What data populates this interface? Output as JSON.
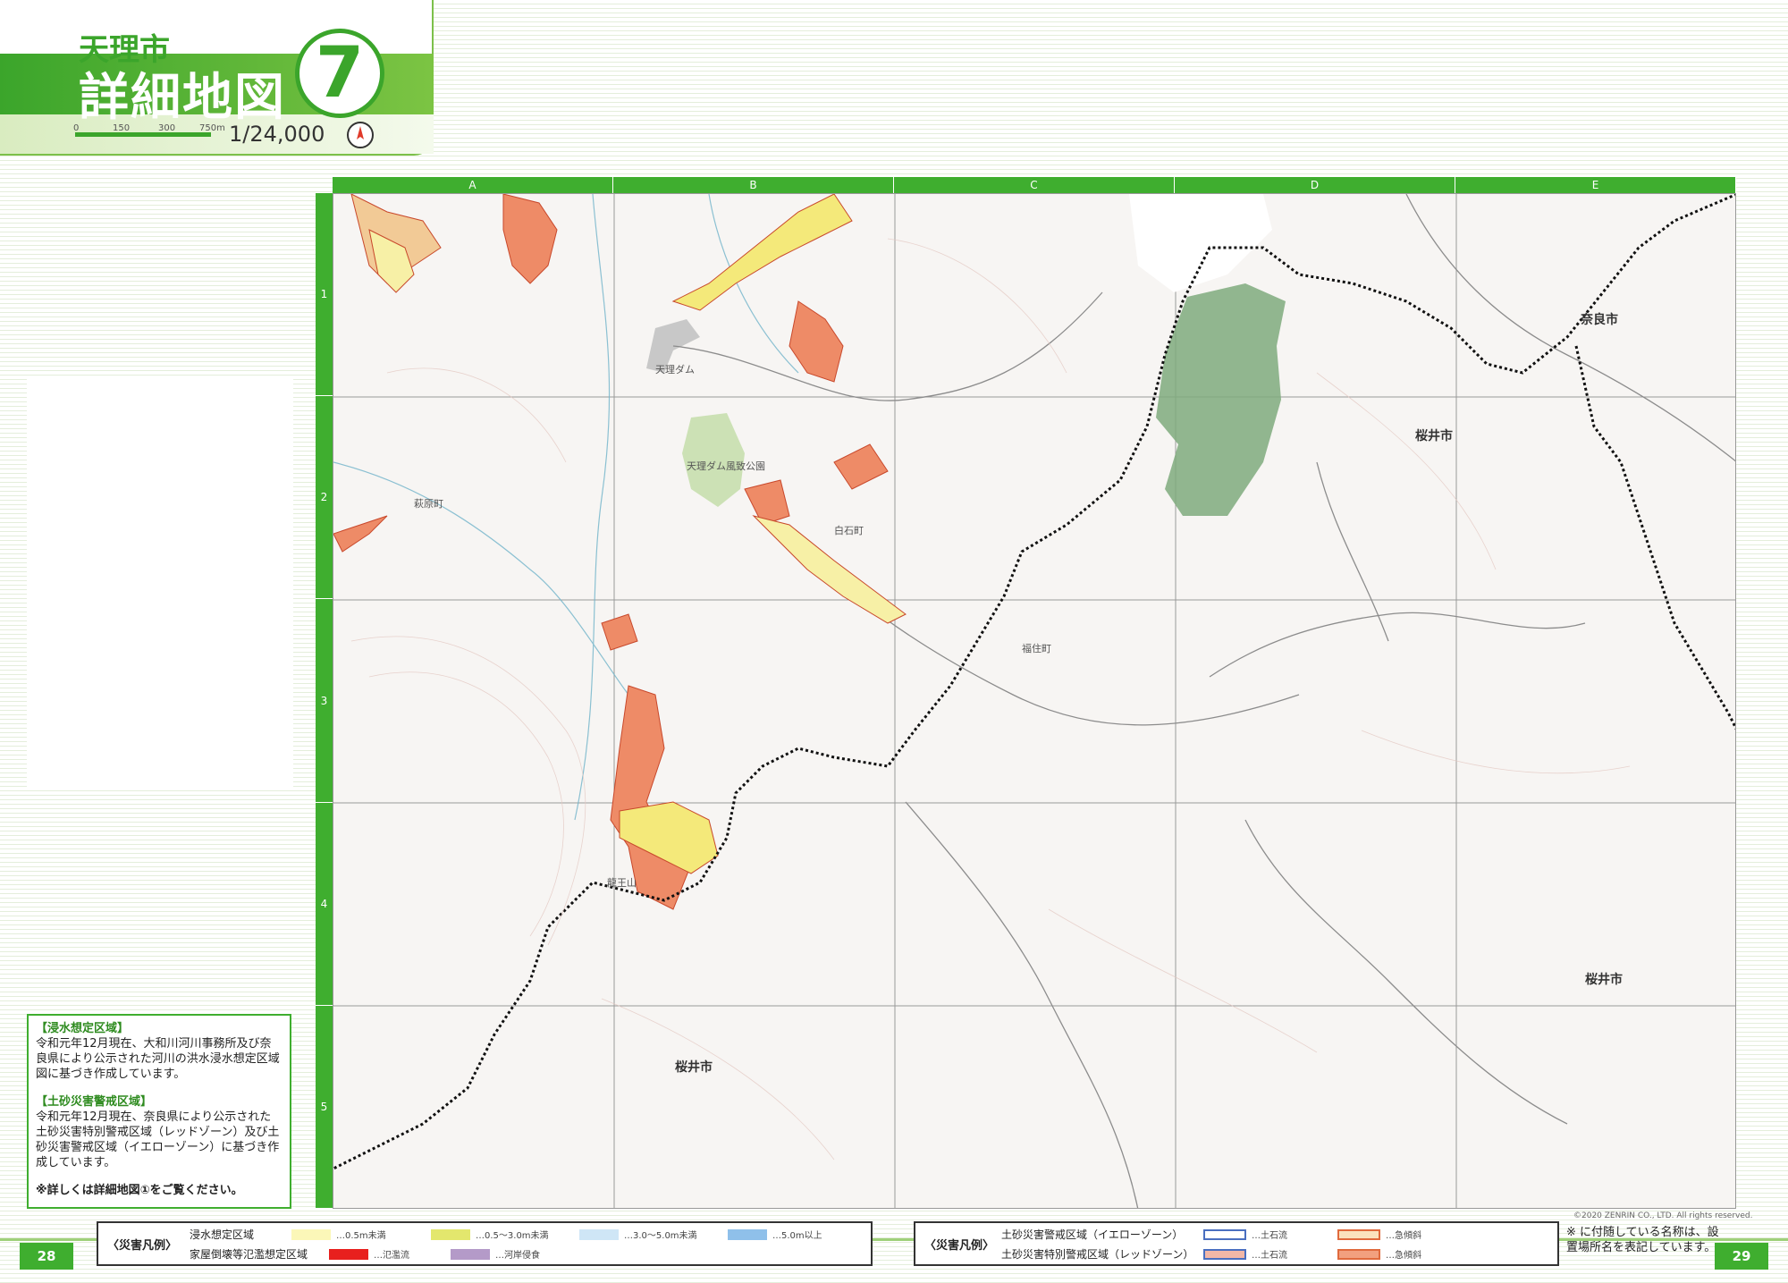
{
  "header": {
    "city": "天理市",
    "title": "詳細地図",
    "page_number": "7",
    "scale_ticks": [
      "0",
      "150",
      "300",
      "750m"
    ],
    "scale_ratio": "1/24,000",
    "north_icon": "north-arrow-icon"
  },
  "grid": {
    "columns": [
      "A",
      "B",
      "C",
      "D",
      "E"
    ],
    "rows": [
      "1",
      "2",
      "3",
      "4",
      "5"
    ]
  },
  "map": {
    "labels": {
      "tenri_dam": "天理ダム",
      "dam_park": "天理ダム風致公園",
      "hagiwara": "萩原町",
      "nara_city": "奈良市",
      "sakurai_city_1": "桜井市",
      "sakurai_city_2": "桜井市",
      "sakurai_city_3": "桜井市",
      "ryuozan": "龍王山",
      "misen": "白石町",
      "funa": "福住町"
    },
    "copyright": "©2020 ZENRIN CO., LTD. All rights reserved."
  },
  "info": {
    "flood_head": "【浸水想定区域】",
    "flood_text": "令和元年12月現在、大和川河川事務所及び奈良県により公示された河川の洪水浸水想定区域図に基づき作成しています。",
    "sediment_head": "【土砂災害警戒区域】",
    "sediment_text": "令和元年12月現在、奈良県により公示された土砂災害特別警戒区域（レッドゾーン）及び土砂災害警戒区域（イエローゾーン）に基づき作成しています。",
    "detail_note": "※詳しくは詳細地図①をご覧ください。"
  },
  "footer": {
    "page_left": "28",
    "page_right": "29",
    "legend_left": {
      "title": "〈災害凡例〉",
      "flood_label": "浸水想定区域",
      "collapse_label": "家屋倒壊等氾濫想定区域",
      "depth_items": [
        {
          "label": "…0.5m未満",
          "color": "#fbf7b8"
        },
        {
          "label": "…0.5〜3.0m未満",
          "color": "#e3e76d"
        },
        {
          "label": "…3.0〜5.0m未満",
          "color": "#cfe6f6"
        },
        {
          "label": "…5.0m以上",
          "color": "#8fc0ea"
        }
      ],
      "collapse_items": [
        {
          "label": "…氾濫流",
          "color": "#e8201e"
        },
        {
          "label": "…河岸侵食",
          "color": "#b49ac8"
        }
      ]
    },
    "legend_right": {
      "title": "〈災害凡例〉",
      "yellow_zone": "土砂災害警戒区域（イエローゾーン）",
      "red_zone": "土砂災害特別警戒区域（レッドゾーン）",
      "items": [
        "…土石流",
        "…急傾斜",
        "…土石流",
        "…急傾斜"
      ]
    },
    "note": "※ に付随している名称は、設置場所名を表記しています。"
  }
}
